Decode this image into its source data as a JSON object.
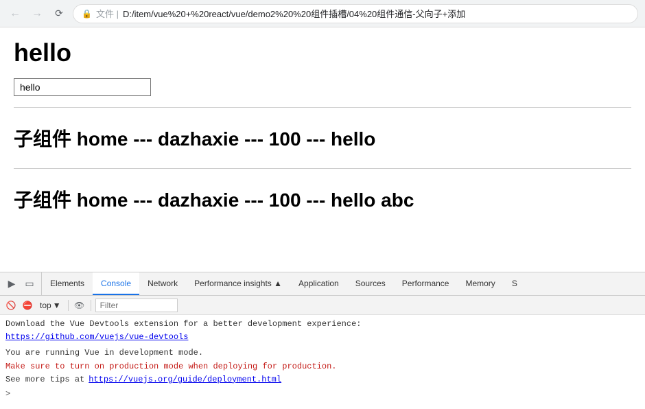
{
  "browser": {
    "back_disabled": true,
    "forward_disabled": true,
    "address_icon": "🔒",
    "address_prefix": "文件 |",
    "address_url": "D:/item/vue%20+%20react/vue/demo2%20%20组件插槽/04%20组件通信-父向子+添加"
  },
  "main": {
    "title": "hello",
    "input_value": "hello",
    "input_placeholder": "",
    "child1": "子组件 home --- dazhaxie --- 100 --- hello",
    "child2": "子组件 home --- dazhaxie --- 100 --- hello abc"
  },
  "devtools": {
    "tabs": [
      {
        "label": "Elements",
        "active": false
      },
      {
        "label": "Console",
        "active": true
      },
      {
        "label": "Network",
        "active": false
      },
      {
        "label": "Performance insights ▲",
        "active": false
      },
      {
        "label": "Application",
        "active": false
      },
      {
        "label": "Sources",
        "active": false
      },
      {
        "label": "Performance",
        "active": false
      },
      {
        "label": "Memory",
        "active": false
      },
      {
        "label": "S",
        "active": false
      }
    ],
    "toolbar": {
      "context_selector": "top",
      "filter_placeholder": "Filter"
    },
    "console": {
      "line1": "Download the Vue Devtools extension for a better development experience:",
      "link1": "https://github.com/vuejs/vue-devtools",
      "line2": "You are running Vue in development mode.",
      "line3": "Make sure to turn on production mode when deploying for production.",
      "line4_prefix": "See more tips at ",
      "link2": "https://vuejs.org/guide/deployment.html"
    }
  }
}
